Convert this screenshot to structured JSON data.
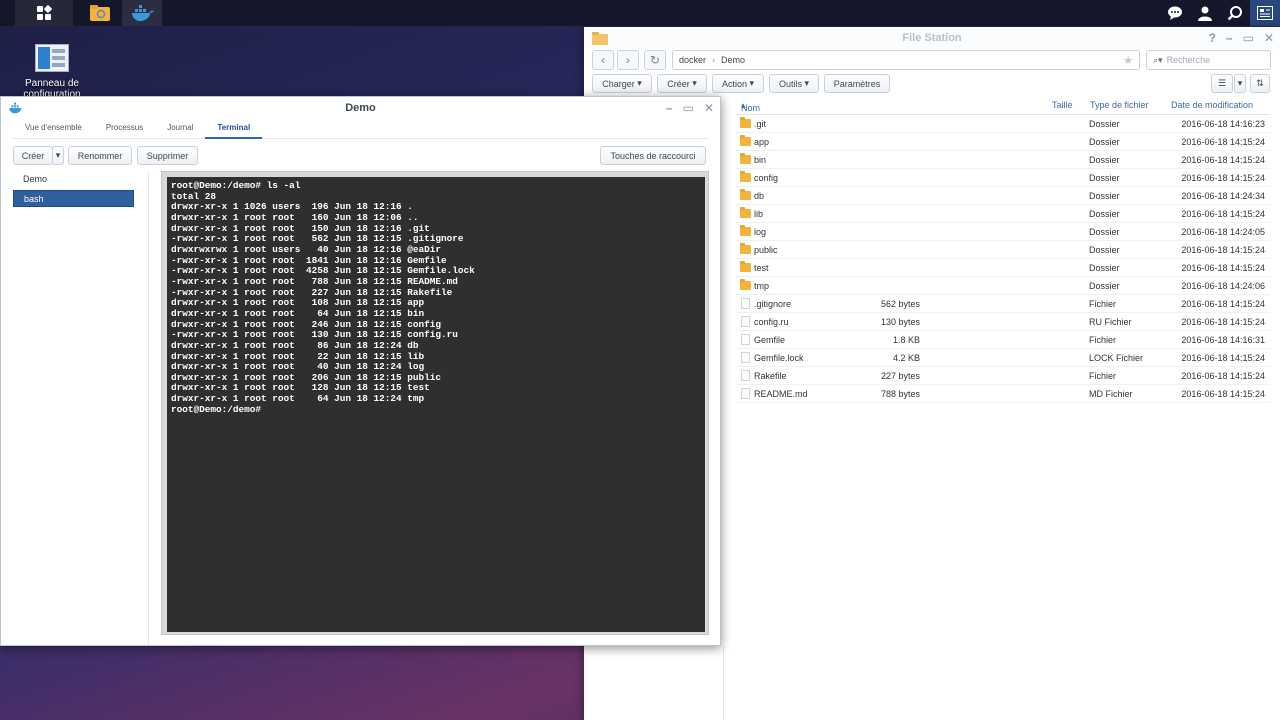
{
  "desktop": {
    "icon_label": "Panneau de configuration"
  },
  "taskbar": {
    "right_icons": [
      "chat-icon",
      "user-icon",
      "search-icon",
      "widgets-icon"
    ]
  },
  "file_station": {
    "title": "File Station",
    "path": [
      "docker",
      "Demo"
    ],
    "search_placeholder": "Recherche",
    "toolbar": {
      "upload": "Charger",
      "create": "Créer",
      "action": "Action",
      "tools": "Outils",
      "settings": "Paramètres"
    },
    "columns": {
      "name": "Nom",
      "size": "Taille",
      "type": "Type de fichier",
      "date": "Date de modification"
    },
    "rows": [
      {
        "name": ".git",
        "size": "",
        "type": "Dossier",
        "date": "2016-06-18 14:16:23",
        "kind": "folder"
      },
      {
        "name": "app",
        "size": "",
        "type": "Dossier",
        "date": "2016-06-18 14:15:24",
        "kind": "folder"
      },
      {
        "name": "bin",
        "size": "",
        "type": "Dossier",
        "date": "2016-06-18 14:15:24",
        "kind": "folder"
      },
      {
        "name": "config",
        "size": "",
        "type": "Dossier",
        "date": "2016-06-18 14:15:24",
        "kind": "folder"
      },
      {
        "name": "db",
        "size": "",
        "type": "Dossier",
        "date": "2016-06-18 14:24:34",
        "kind": "folder"
      },
      {
        "name": "lib",
        "size": "",
        "type": "Dossier",
        "date": "2016-06-18 14:15:24",
        "kind": "folder"
      },
      {
        "name": "log",
        "size": "",
        "type": "Dossier",
        "date": "2016-06-18 14:24:05",
        "kind": "folder"
      },
      {
        "name": "public",
        "size": "",
        "type": "Dossier",
        "date": "2016-06-18 14:15:24",
        "kind": "folder"
      },
      {
        "name": "test",
        "size": "",
        "type": "Dossier",
        "date": "2016-06-18 14:15:24",
        "kind": "folder"
      },
      {
        "name": "tmp",
        "size": "",
        "type": "Dossier",
        "date": "2016-06-18 14:24:06",
        "kind": "folder"
      },
      {
        "name": ".gitignore",
        "size": "562 bytes",
        "type": "Fichier",
        "date": "2016-06-18 14:15:24",
        "kind": "file"
      },
      {
        "name": "config.ru",
        "size": "130 bytes",
        "type": "RU Fichier",
        "date": "2016-06-18 14:15:24",
        "kind": "file"
      },
      {
        "name": "Gemfile",
        "size": "1.8 KB",
        "type": "Fichier",
        "date": "2016-06-18 14:16:31",
        "kind": "file"
      },
      {
        "name": "Gemfile.lock",
        "size": "4.2 KB",
        "type": "LOCK Fichier",
        "date": "2016-06-18 14:15:24",
        "kind": "file"
      },
      {
        "name": "Rakefile",
        "size": "227 bytes",
        "type": "Fichier",
        "date": "2016-06-18 14:15:24",
        "kind": "file"
      },
      {
        "name": "README.md",
        "size": "788 bytes",
        "type": "MD Fichier",
        "date": "2016-06-18 14:15:24",
        "kind": "file"
      }
    ]
  },
  "docker": {
    "title": "Demo",
    "tabs": [
      "Vue d'ensemble",
      "Processus",
      "Journal",
      "Terminal"
    ],
    "active_tab": "Terminal",
    "toolbar": {
      "create": "Créer",
      "rename": "Renommer",
      "delete": "Supprimer",
      "shortcuts": "Touches de raccourci"
    },
    "sidebar": [
      "Demo",
      "bash"
    ],
    "selected_session": "bash",
    "terminal_lines": [
      "root@Demo:/demo# ls -al",
      "total 28",
      "drwxr-xr-x 1 1026 users  196 Jun 18 12:16 .",
      "drwxr-xr-x 1 root root   160 Jun 18 12:06 ..",
      "drwxr-xr-x 1 root root   150 Jun 18 12:16 .git",
      "-rwxr-xr-x 1 root root   562 Jun 18 12:15 .gitignore",
      "drwxrwxrwx 1 root users   40 Jun 18 12:16 @eaDir",
      "-rwxr-xr-x 1 root root  1841 Jun 18 12:16 Gemfile",
      "-rwxr-xr-x 1 root root  4258 Jun 18 12:15 Gemfile.lock",
      "-rwxr-xr-x 1 root root   788 Jun 18 12:15 README.md",
      "-rwxr-xr-x 1 root root   227 Jun 18 12:15 Rakefile",
      "drwxr-xr-x 1 root root   108 Jun 18 12:15 app",
      "drwxr-xr-x 1 root root    64 Jun 18 12:15 bin",
      "drwxr-xr-x 1 root root   246 Jun 18 12:15 config",
      "-rwxr-xr-x 1 root root   130 Jun 18 12:15 config.ru",
      "drwxr-xr-x 1 root root    86 Jun 18 12:24 db",
      "drwxr-xr-x 1 root root    22 Jun 18 12:15 lib",
      "drwxr-xr-x 1 root root    40 Jun 18 12:24 log",
      "drwxr-xr-x 1 root root   206 Jun 18 12:15 public",
      "drwxr-xr-x 1 root root   128 Jun 18 12:15 test",
      "drwxr-xr-x 1 root root    64 Jun 18 12:24 tmp",
      "root@Demo:/demo#"
    ]
  }
}
